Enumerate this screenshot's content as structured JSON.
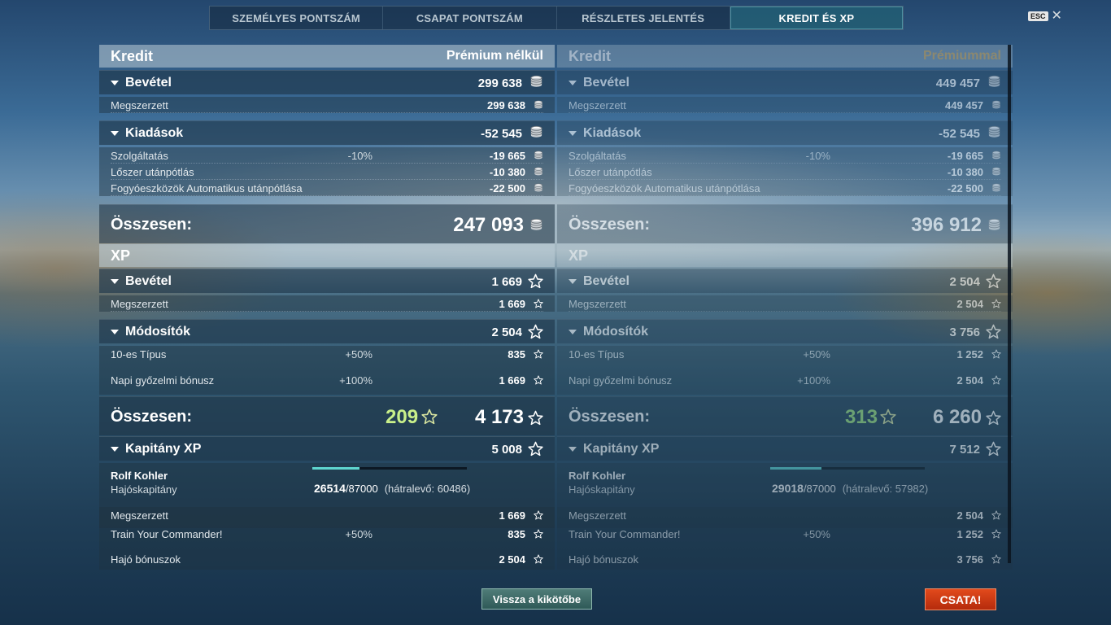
{
  "tabs": [
    "SZEMÉLYES PONTSZÁM",
    "CSAPAT PONTSZÁM",
    "RÉSZLETES JELENTÉS",
    "KREDIT ÉS XP"
  ],
  "active_tab": "KREDIT ÉS XP",
  "esc_label": "ESC",
  "close_glyph": "✕",
  "icons": {
    "credit": "credit-coin-icon",
    "xp": "xp-star-icon",
    "expand": "triangle-down-icon"
  },
  "colors": {
    "bonus_xp": "#c9f08a",
    "premium_label": "#d8b062",
    "accent_tab": "#2878a0",
    "battle_button": "#d23b14"
  },
  "left": {
    "credit_title": "Kredit",
    "credit_mode": "Prémium nélkül",
    "income_label": "Bevétel",
    "income_value": "299 638",
    "earned_label": "Megszerzett",
    "earned_value": "299 638",
    "expenses_label": "Kiadások",
    "expenses_value": "-52 545",
    "service_label": "Szolgáltatás",
    "service_pct": "-10%",
    "service_value": "-19 665",
    "ammo_label": "Lőszer utánpótlás",
    "ammo_value": "-10 380",
    "consumables_label": "Fogyóeszközök Automatikus utánpótlása",
    "consumables_value": "-22 500",
    "credit_total_label": "Összesen:",
    "credit_total_value": "247 093",
    "xp_title": "XP",
    "xp_income_label": "Bevétel",
    "xp_income_value": "1 669",
    "xp_earned_label": "Megszerzett",
    "xp_earned_value": "1 669",
    "modifiers_label": "Módosítók",
    "modifiers_value": "2 504",
    "tier_label": "10-es Típus",
    "tier_pct": "+50%",
    "tier_value": "835",
    "daily_label": "Napi győzelmi bónusz",
    "daily_pct": "+100%",
    "daily_value": "1 669",
    "xp_total_label": "Összesen:",
    "xp_total_free": "209",
    "xp_total_value": "4 173",
    "captain_label": "Kapitány XP",
    "captain_value": "5 008",
    "captain_name": "Rolf Kohler",
    "captain_rank": "Hajóskapitány",
    "captain_xp_current": "26514",
    "captain_xp_max": "/87000",
    "captain_xp_remaining": "(hátralevő: 60486)",
    "captain_progress": 0.3048,
    "cap_earned_label": "Megszerzett",
    "cap_earned_value": "1 669",
    "train_label": "Train Your Commander!",
    "train_pct": "+50%",
    "train_value": "835",
    "ship_bonus_label": "Hajó bónuszok",
    "ship_bonus_value": "2 504"
  },
  "right": {
    "credit_title": "Kredit",
    "credit_mode": "Prémiummal",
    "income_label": "Bevétel",
    "income_value": "449 457",
    "earned_label": "Megszerzett",
    "earned_value": "449 457",
    "expenses_label": "Kiadások",
    "expenses_value": "-52 545",
    "service_label": "Szolgáltatás",
    "service_pct": "-10%",
    "service_value": "-19 665",
    "ammo_label": "Lőszer utánpótlás",
    "ammo_value": "-10 380",
    "consumables_label": "Fogyóeszközök Automatikus utánpótlása",
    "consumables_value": "-22 500",
    "credit_total_label": "Összesen:",
    "credit_total_value": "396 912",
    "xp_title": "XP",
    "xp_income_label": "Bevétel",
    "xp_income_value": "2 504",
    "xp_earned_label": "Megszerzett",
    "xp_earned_value": "2 504",
    "modifiers_label": "Módosítók",
    "modifiers_value": "3 756",
    "tier_label": "10-es Típus",
    "tier_pct": "+50%",
    "tier_value": "1 252",
    "daily_label": "Napi győzelmi bónusz",
    "daily_pct": "+100%",
    "daily_value": "2 504",
    "xp_total_label": "Összesen:",
    "xp_total_free": "313",
    "xp_total_value": "6 260",
    "captain_label": "Kapitány XP",
    "captain_value": "7 512",
    "captain_name": "Rolf Kohler",
    "captain_rank": "Hajóskapitány",
    "captain_xp_current": "29018",
    "captain_xp_max": "/87000",
    "captain_xp_remaining": "(hátralevő: 57982)",
    "captain_progress": 0.3335,
    "cap_earned_label": "Megszerzett",
    "cap_earned_value": "2 504",
    "train_label": "Train Your Commander!",
    "train_pct": "+50%",
    "train_value": "1 252",
    "ship_bonus_label": "Hajó bónuszok",
    "ship_bonus_value": "3 756"
  },
  "buttons": {
    "back": "Vissza a kikötőbe",
    "battle": "CSATA!"
  }
}
